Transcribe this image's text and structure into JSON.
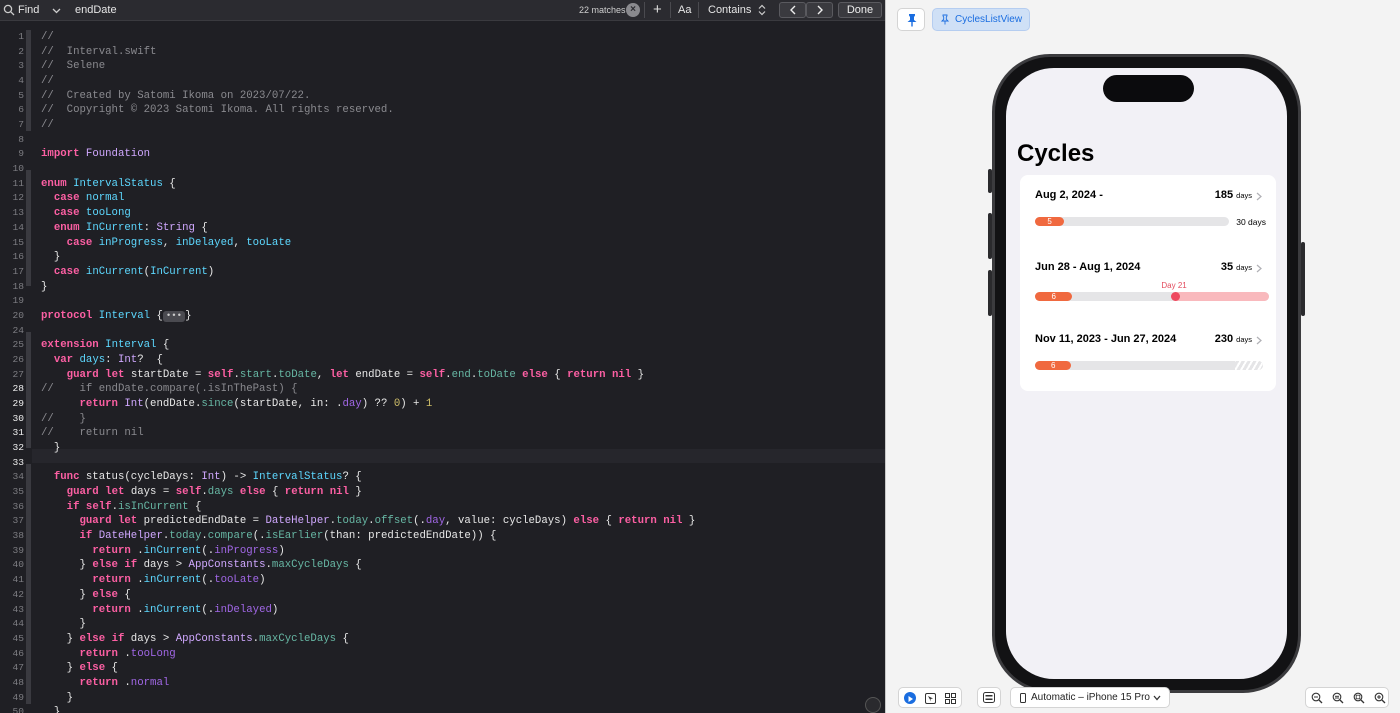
{
  "find": {
    "mode": "Find",
    "query": "endDate",
    "matches": "22 matches",
    "case_toggle": "Aa",
    "match_mode": "Contains",
    "done": "Done"
  },
  "code_lines": [
    {
      "n": "1",
      "text": "//"
    },
    {
      "n": "2",
      "text": "//  Interval.swift"
    },
    {
      "n": "3",
      "text": "//  Selene"
    },
    {
      "n": "4",
      "text": "//"
    },
    {
      "n": "5",
      "text": "//  Created by Satomi Ikoma on 2023/07/22."
    },
    {
      "n": "6",
      "text": "//  Copyright © 2023 Satomi Ikoma. All rights reserved."
    },
    {
      "n": "7",
      "text": "//"
    },
    {
      "n": "8",
      "text": ""
    },
    {
      "n": "9",
      "text": "import Foundation"
    },
    {
      "n": "10",
      "text": ""
    },
    {
      "n": "11",
      "text": "enum IntervalStatus {"
    },
    {
      "n": "12",
      "text": "  case normal"
    },
    {
      "n": "13",
      "text": "  case tooLong"
    },
    {
      "n": "14",
      "text": "  enum InCurrent: String {"
    },
    {
      "n": "15",
      "text": "    case inProgress, inDelayed, tooLate"
    },
    {
      "n": "16",
      "text": "  }"
    },
    {
      "n": "17",
      "text": "  case inCurrent(InCurrent)"
    },
    {
      "n": "18",
      "text": "}"
    },
    {
      "n": "19",
      "text": ""
    },
    {
      "n": "20",
      "text": "protocol Interval {•••}"
    },
    {
      "n": "24",
      "text": ""
    },
    {
      "n": "25",
      "text": "extension Interval {"
    },
    {
      "n": "26",
      "text": "  var days: Int?  {"
    },
    {
      "n": "27",
      "text": "    guard let startDate = self.start.toDate, let endDate = self.end.toDate else { return nil }"
    },
    {
      "n": "28",
      "text": "//    if endDate.compare(.isInThePast) {"
    },
    {
      "n": "29",
      "text": "      return Int(endDate.since(startDate, in: .day) ?? 0) + 1"
    },
    {
      "n": "30",
      "text": "//    }"
    },
    {
      "n": "31",
      "text": "//    return nil"
    },
    {
      "n": "32",
      "text": "  }"
    },
    {
      "n": "33",
      "text": ""
    },
    {
      "n": "34",
      "text": "  func status(cycleDays: Int) -> IntervalStatus? {"
    },
    {
      "n": "35",
      "text": "    guard let days = self.days else { return nil }"
    },
    {
      "n": "36",
      "text": "    if self.isInCurrent {"
    },
    {
      "n": "37",
      "text": "      guard let predictedEndDate = DateHelper.today.offset(.day, value: cycleDays) else { return nil }"
    },
    {
      "n": "38",
      "text": "      if DateHelper.today.compare(.isEarlier(than: predictedEndDate)) {"
    },
    {
      "n": "39",
      "text": "        return .inCurrent(.inProgress)"
    },
    {
      "n": "40",
      "text": "      } else if days > AppConstants.maxCycleDays {"
    },
    {
      "n": "41",
      "text": "        return .inCurrent(.tooLate)"
    },
    {
      "n": "42",
      "text": "      } else {"
    },
    {
      "n": "43",
      "text": "        return .inCurrent(.inDelayed)"
    },
    {
      "n": "44",
      "text": "      }"
    },
    {
      "n": "45",
      "text": "    } else if days > AppConstants.maxCycleDays {"
    },
    {
      "n": "46",
      "text": "      return .tooLong"
    },
    {
      "n": "47",
      "text": "    } else {"
    },
    {
      "n": "48",
      "text": "      return .normal"
    },
    {
      "n": "49",
      "text": "    }"
    },
    {
      "n": "50",
      "text": "  }"
    }
  ],
  "preview": {
    "tag": "CyclesListView",
    "device": "Automatic – iPhone 15 Pro",
    "screen_title": "Cycles",
    "cycles": [
      {
        "label": "Aug 2, 2024 -",
        "days": "185",
        "unit": "days",
        "bar_value": "5",
        "bar_fill": 0.15,
        "end_label": "30 days"
      },
      {
        "label": "Jun 28 - Aug 1, 2024",
        "days": "35",
        "unit": "days",
        "bar_value": "6",
        "bar_fill": 0.16,
        "day_marker": "Day 21",
        "day_marker_pos": 0.6
      },
      {
        "label": "Nov 11, 2023 - Jun 27, 2024",
        "days": "230",
        "unit": "days",
        "bar_value": "6",
        "bar_fill": 0.16
      }
    ]
  }
}
